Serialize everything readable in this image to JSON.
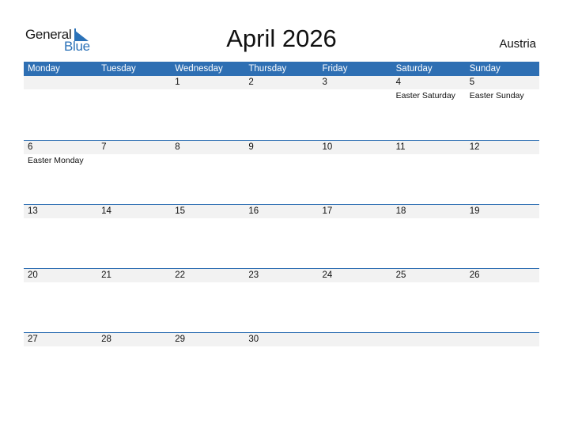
{
  "logo": {
    "word1": "General",
    "word2": "Blue",
    "brand_color": "#2b72b8"
  },
  "title": "April 2026",
  "country": "Austria",
  "colors": {
    "header_bg": "#2e6fb3",
    "date_strip_bg": "#f2f2f2",
    "row_border": "#2e6fb3"
  },
  "weekdays": [
    "Monday",
    "Tuesday",
    "Wednesday",
    "Thursday",
    "Friday",
    "Saturday",
    "Sunday"
  ],
  "weeks": [
    {
      "days": [
        "",
        "",
        "1",
        "2",
        "3",
        "4",
        "5"
      ],
      "holidays": [
        "",
        "",
        "",
        "",
        "",
        "Easter Saturday",
        "Easter Sunday"
      ]
    },
    {
      "days": [
        "6",
        "7",
        "8",
        "9",
        "10",
        "11",
        "12"
      ],
      "holidays": [
        "Easter Monday",
        "",
        "",
        "",
        "",
        "",
        ""
      ]
    },
    {
      "days": [
        "13",
        "14",
        "15",
        "16",
        "17",
        "18",
        "19"
      ],
      "holidays": [
        "",
        "",
        "",
        "",
        "",
        "",
        ""
      ]
    },
    {
      "days": [
        "20",
        "21",
        "22",
        "23",
        "24",
        "25",
        "26"
      ],
      "holidays": [
        "",
        "",
        "",
        "",
        "",
        "",
        ""
      ]
    },
    {
      "days": [
        "27",
        "28",
        "29",
        "30",
        "",
        "",
        ""
      ],
      "holidays": [
        "",
        "",
        "",
        "",
        "",
        "",
        ""
      ]
    }
  ]
}
